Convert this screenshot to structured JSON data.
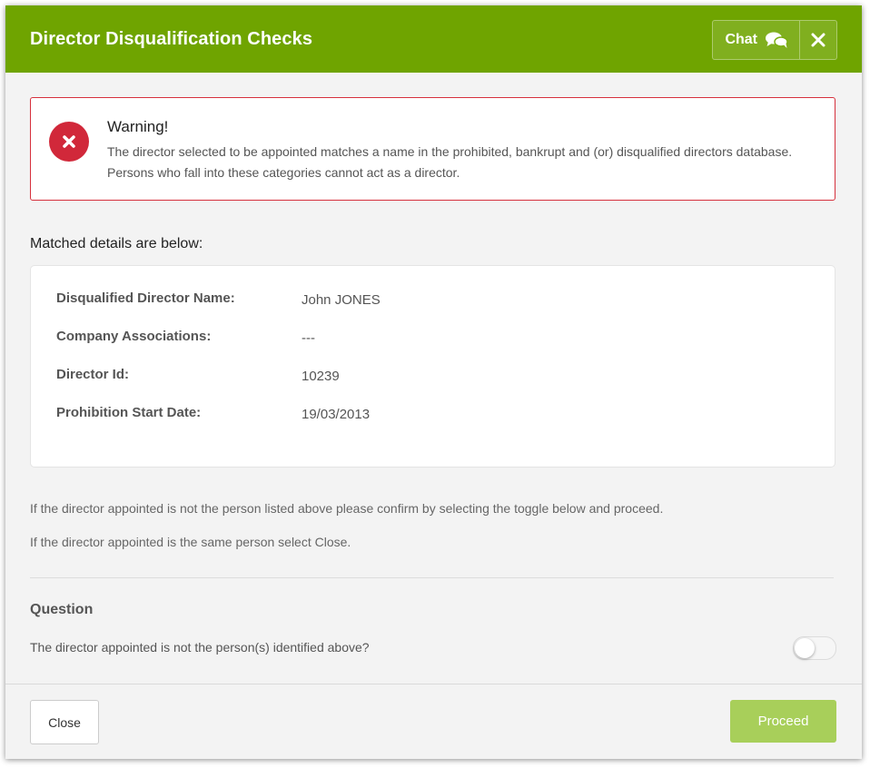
{
  "header": {
    "title": "Director Disqualification Checks",
    "chat_label": "Chat",
    "chat_icon": "chat-bubbles-icon",
    "close_icon": "close-icon"
  },
  "warning": {
    "icon": "error-x-icon",
    "title": "Warning!",
    "message": "The director selected to be appointed matches a name in the prohibited, bankrupt and (or) disqualified directors database. Persons who fall into these categories cannot act as a director."
  },
  "matched_heading": "Matched details are below:",
  "details": [
    {
      "label": "Disqualified Director Name:",
      "value": "John JONES"
    },
    {
      "label": "Company Associations:",
      "value": "---"
    },
    {
      "label": "Director Id:",
      "value": "10239"
    },
    {
      "label": "Prohibition Start Date:",
      "value": "19/03/2013"
    }
  ],
  "info": {
    "line1": "If the director appointed is not the person listed above please confirm by selecting the toggle below and proceed.",
    "line2": "If the director appointed is the same person select Close."
  },
  "question": {
    "heading": "Question",
    "text": "The director appointed is not the person(s) identified above?",
    "toggle_on": false
  },
  "footer": {
    "close_label": "Close",
    "proceed_label": "Proceed"
  },
  "colors": {
    "header_green": "#6fa400",
    "proceed_green": "#a8cf5a",
    "warning_red": "#d1283a"
  }
}
